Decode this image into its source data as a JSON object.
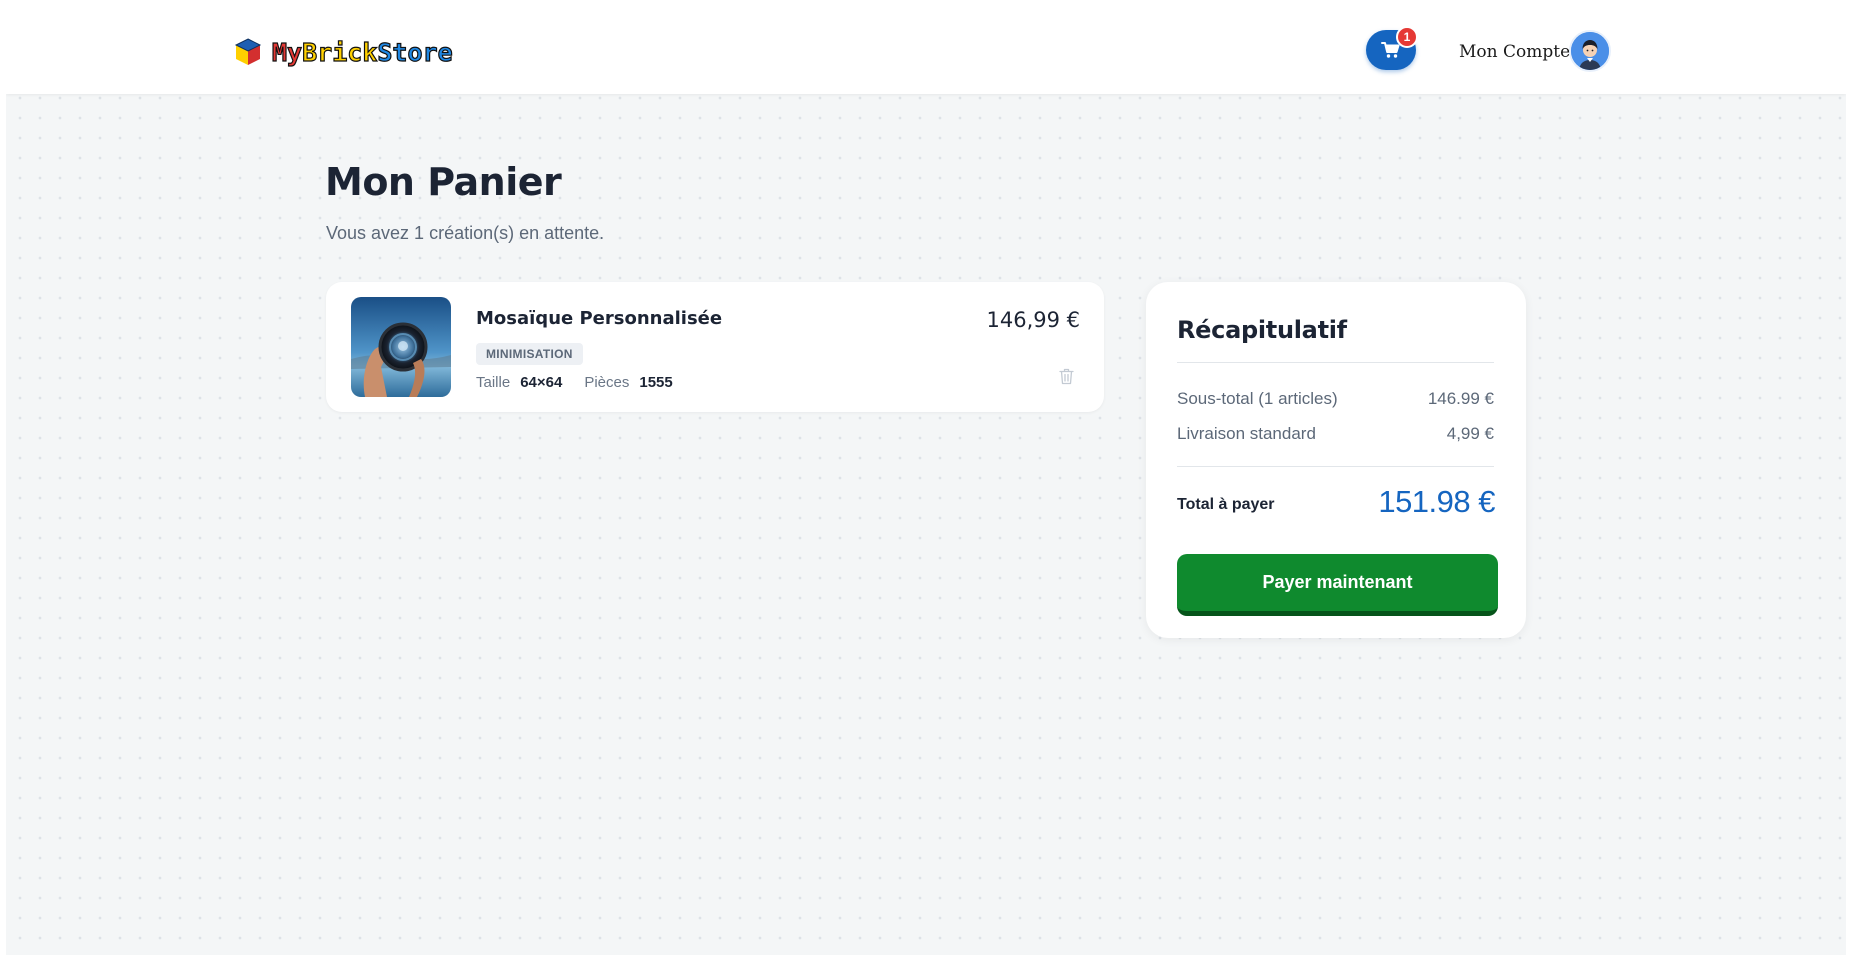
{
  "header": {
    "logo": {
      "part1": "My",
      "part2": "Brick",
      "part3": "Store"
    },
    "cart_count": "1",
    "account_label": "Mon Compte"
  },
  "page": {
    "title": "Mon Panier",
    "subtitle": "Vous avez 1 création(s) en attente."
  },
  "cart_items": [
    {
      "name": "Mosaïque Personnalisée",
      "tag": "MINIMISATION",
      "size_label": "Taille",
      "size_value": "64×64",
      "pieces_label": "Pièces",
      "pieces_value": "1555",
      "price": "146,99 €"
    }
  ],
  "summary": {
    "title": "Récapitulatif",
    "subtotal_label": "Sous-total (1 articles)",
    "subtotal_value": "146.99 €",
    "shipping_label": "Livraison standard",
    "shipping_value": "4,99 €",
    "total_label": "Total à payer",
    "total_value": "151.98 €",
    "pay_button": "Payer maintenant"
  },
  "colors": {
    "accent_blue": "#1565c0",
    "pay_green": "#0f8a2e",
    "badge_red": "#e53935",
    "text_dark": "#1c2434"
  }
}
